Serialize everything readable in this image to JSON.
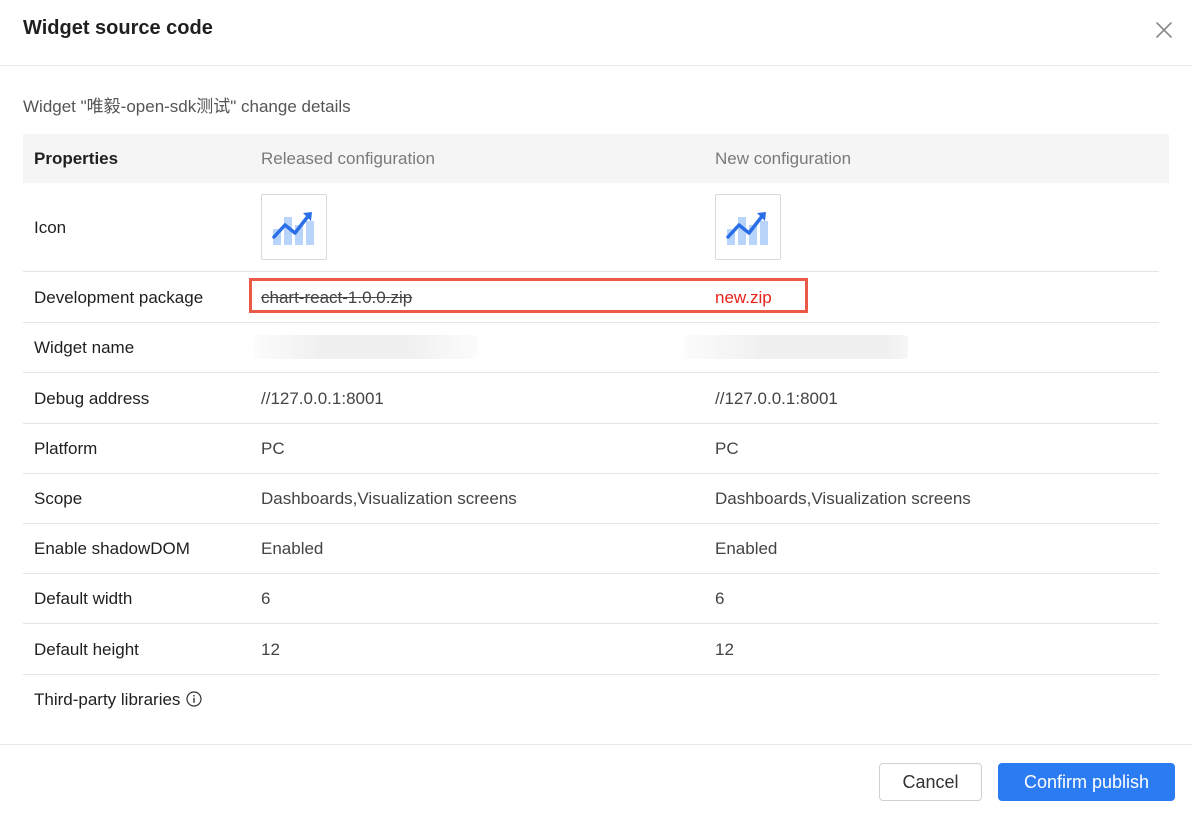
{
  "dialog": {
    "title": "Widget source code",
    "subtitle": "Widget \"唯毅-open-sdk测试\" change details"
  },
  "table": {
    "headers": {
      "properties": "Properties",
      "released": "Released configuration",
      "new": "New configuration"
    },
    "rows": {
      "icon": {
        "label": "Icon"
      },
      "package": {
        "label": "Development package",
        "released": "chart-react-1.0.0.zip",
        "new": "new.zip"
      },
      "widget_name": {
        "label": "Widget name"
      },
      "debug": {
        "label": "Debug address",
        "released": "//127.0.0.1:8001",
        "new": "//127.0.0.1:8001"
      },
      "platform": {
        "label": "Platform",
        "released": "PC",
        "new": "PC"
      },
      "scope": {
        "label": "Scope",
        "released": "Dashboards,Visualization screens",
        "new": "Dashboards,Visualization screens"
      },
      "shadow": {
        "label": "Enable shadowDOM",
        "released": "Enabled",
        "new": "Enabled"
      },
      "width": {
        "label": "Default width",
        "released": "6",
        "new": "6"
      },
      "height": {
        "label": "Default height",
        "released": "12",
        "new": "12"
      },
      "libs": {
        "label": "Third-party libraries"
      }
    }
  },
  "footer": {
    "cancel": "Cancel",
    "confirm": "Confirm publish"
  },
  "colors": {
    "primary": "#2b7bf3",
    "changed_text": "#e8211b",
    "highlight_border": "#ea5a47"
  },
  "icons": {
    "close": "close-icon",
    "widget": "chart-trend-icon",
    "info": "info-circle-icon"
  }
}
